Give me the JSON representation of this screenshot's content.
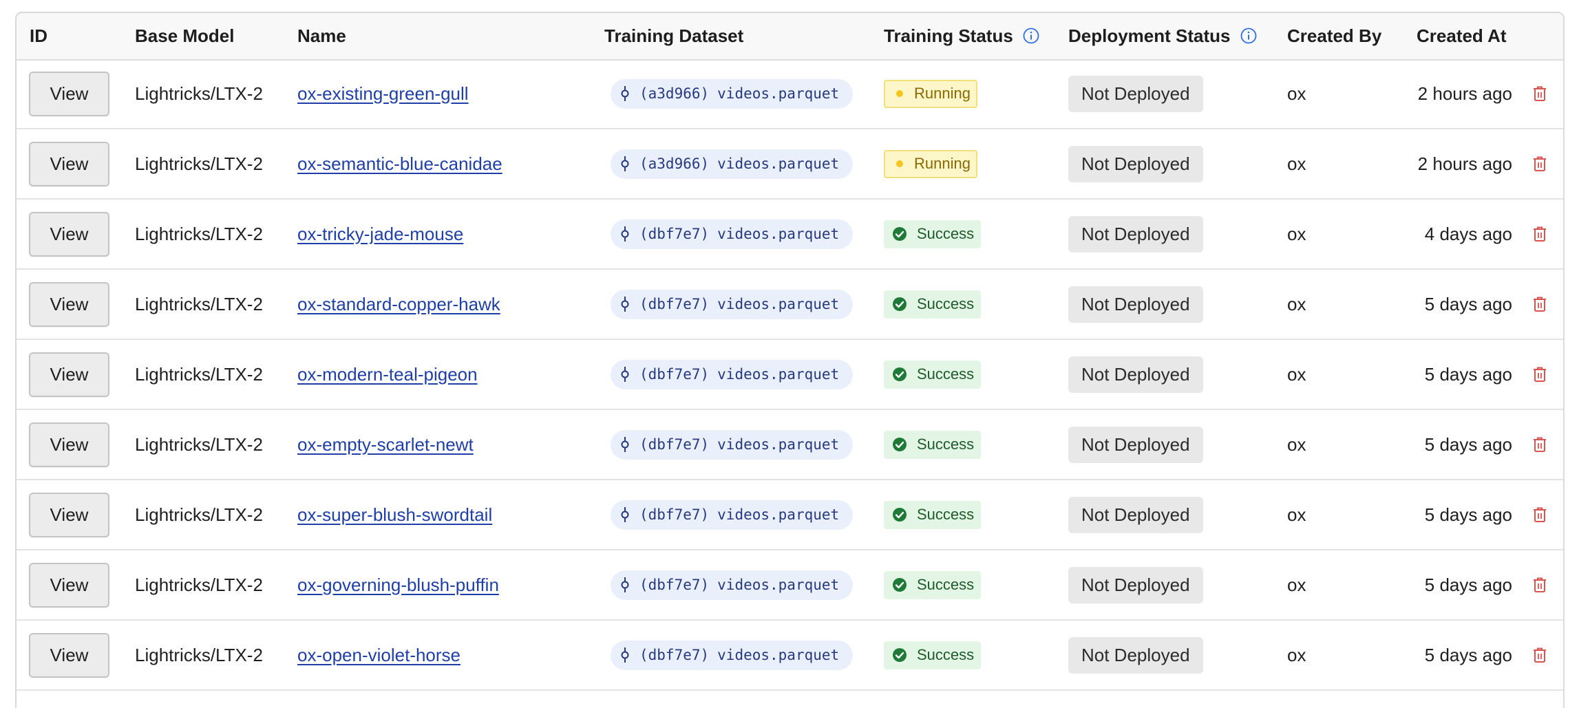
{
  "table": {
    "headers": {
      "id": "ID",
      "base_model": "Base Model",
      "name": "Name",
      "training_dataset": "Training Dataset",
      "training_status": "Training Status",
      "deployment_status": "Deployment Status",
      "created_by": "Created By",
      "created_at": "Created At"
    },
    "view_label": "View",
    "rows": [
      {
        "base_model": "Lightricks/LTX-2",
        "name": "ox-existing-green-gull",
        "dataset_hash": "(a3d966)",
        "dataset_file": "videos.parquet",
        "training_status": "Running",
        "deployment_status": "Not Deployed",
        "created_by": "ox",
        "created_at": "2 hours ago"
      },
      {
        "base_model": "Lightricks/LTX-2",
        "name": "ox-semantic-blue-canidae",
        "dataset_hash": "(a3d966)",
        "dataset_file": "videos.parquet",
        "training_status": "Running",
        "deployment_status": "Not Deployed",
        "created_by": "ox",
        "created_at": "2 hours ago"
      },
      {
        "base_model": "Lightricks/LTX-2",
        "name": "ox-tricky-jade-mouse",
        "dataset_hash": "(dbf7e7)",
        "dataset_file": "videos.parquet",
        "training_status": "Success",
        "deployment_status": "Not Deployed",
        "created_by": "ox",
        "created_at": "4 days ago"
      },
      {
        "base_model": "Lightricks/LTX-2",
        "name": "ox-standard-copper-hawk",
        "dataset_hash": "(dbf7e7)",
        "dataset_file": "videos.parquet",
        "training_status": "Success",
        "deployment_status": "Not Deployed",
        "created_by": "ox",
        "created_at": "5 days ago"
      },
      {
        "base_model": "Lightricks/LTX-2",
        "name": "ox-modern-teal-pigeon",
        "dataset_hash": "(dbf7e7)",
        "dataset_file": "videos.parquet",
        "training_status": "Success",
        "deployment_status": "Not Deployed",
        "created_by": "ox",
        "created_at": "5 days ago"
      },
      {
        "base_model": "Lightricks/LTX-2",
        "name": "ox-empty-scarlet-newt",
        "dataset_hash": "(dbf7e7)",
        "dataset_file": "videos.parquet",
        "training_status": "Success",
        "deployment_status": "Not Deployed",
        "created_by": "ox",
        "created_at": "5 days ago"
      },
      {
        "base_model": "Lightricks/LTX-2",
        "name": "ox-super-blush-swordtail",
        "dataset_hash": "(dbf7e7)",
        "dataset_file": "videos.parquet",
        "training_status": "Success",
        "deployment_status": "Not Deployed",
        "created_by": "ox",
        "created_at": "5 days ago"
      },
      {
        "base_model": "Lightricks/LTX-2",
        "name": "ox-governing-blush-puffin",
        "dataset_hash": "(dbf7e7)",
        "dataset_file": "videos.parquet",
        "training_status": "Success",
        "deployment_status": "Not Deployed",
        "created_by": "ox",
        "created_at": "5 days ago"
      },
      {
        "base_model": "Lightricks/LTX-2",
        "name": "ox-open-violet-horse",
        "dataset_hash": "(dbf7e7)",
        "dataset_file": "videos.parquet",
        "training_status": "Success",
        "deployment_status": "Not Deployed",
        "created_by": "ox",
        "created_at": "5 days ago"
      }
    ]
  },
  "icons": {
    "info": "info-circle-icon",
    "dataset": "git-commit-icon",
    "running": "dot-icon",
    "success": "check-circle-icon",
    "delete": "trash-icon"
  },
  "colors": {
    "link": "#1f3fa8",
    "running_bg": "#fdf6c9",
    "running_dot": "#f3c61f",
    "success_bg": "#e3f5e5",
    "success_check": "#1e7a36",
    "delete": "#d9534f",
    "info": "#2f6fe0",
    "pill_bg": "#eaf0fb"
  }
}
